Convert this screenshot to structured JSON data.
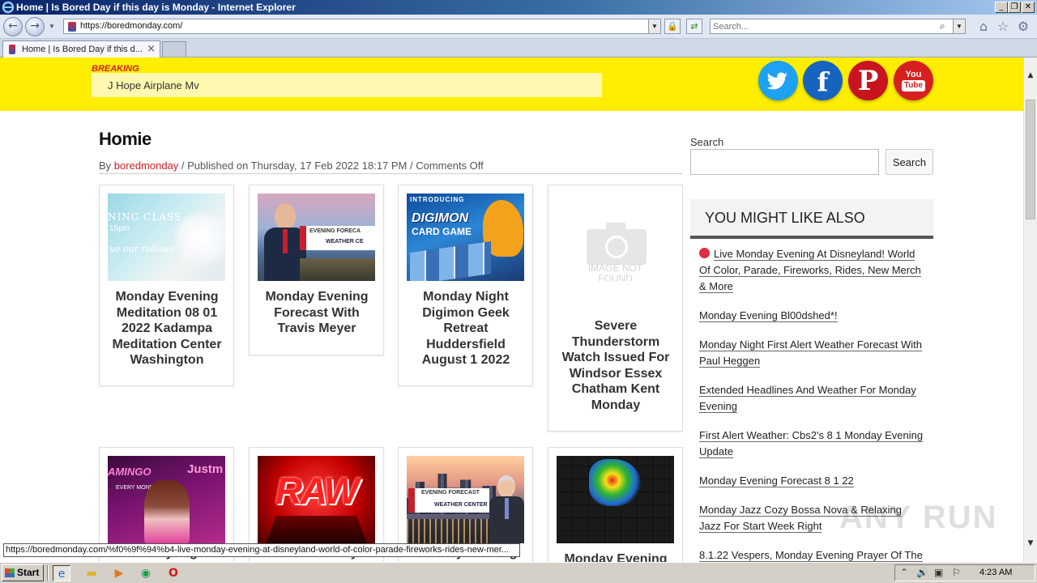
{
  "window": {
    "title": "Home | Is Bored Day if this day is Monday - Internet Explorer",
    "controls": [
      "_",
      "❐",
      "✕"
    ]
  },
  "browser": {
    "url": "https://boredmonday.com/",
    "search_placeholder": "Search...",
    "tab_title": "Home | Is Bored Day if this d...",
    "status_url": "https://boredmonday.com/%f0%9f%94%b4-live-monday-evening-at-disneyland-world-of-color-parade-fireworks-rides-new-mer..."
  },
  "header": {
    "breaking_label": "BREAKING",
    "ticker_text": "J Hope Airplane Mv",
    "social": {
      "facebook": "f",
      "pinterest": "P",
      "youtube_top": "You",
      "youtube_bottom": "Tube"
    }
  },
  "post": {
    "title": "Homie",
    "meta_by": "By ",
    "author": "boredmonday",
    "meta_rest": " / Published on Thursday, 17 Feb 2022 18:17 PM / Comments Off"
  },
  "cards": [
    {
      "title": "Monday Evening Meditation 08 01 2022 Kadampa Meditation Center Washington",
      "thumb_text": [
        "NING CLASS",
        "15pm",
        "ue our rollows"
      ]
    },
    {
      "title": "Monday Evening Forecast With Travis Meyer",
      "thumb_text": [
        "EVENING FORECA",
        "WEATHER CE"
      ]
    },
    {
      "title": "Monday Night Digimon Geek Retreat Huddersfield August 1 2022",
      "thumb_text": [
        "INTRODUCING",
        "DIGIMON",
        "CARD GAME"
      ]
    },
    {
      "title": "Severe Thunderstorm Watch Issued For Windsor Essex Chatham Kent Monday",
      "thumb_text": [
        "IMAGE NOT",
        "FOUND"
      ]
    },
    {
      "title": "Monday Night",
      "thumb_text": [
        "AMINGO",
        "Justm",
        "EVERY MONDAY"
      ]
    },
    {
      "title": "Wwe Monday",
      "thumb_text": [
        "RAW"
      ]
    },
    {
      "title": "Monday Evening",
      "thumb_text": [
        "EVENING FORECAST",
        "WEATHER CENTER"
      ]
    },
    {
      "title": "Monday Evening",
      "thumb_text": []
    }
  ],
  "sidebar": {
    "search_label": "Search",
    "search_button": "Search",
    "section_title": "YOU MIGHT LIKE ALSO",
    "links": [
      "Live Monday Evening At Disneyland! World Of Color, Parade, Fireworks, Rides, New Merch & More",
      "Monday Evening Bl00dshed*!",
      "Monday Night First Alert Weather Forecast With Paul Heggen",
      "Extended Headlines And Weather For Monday Evening",
      "First Alert Weather: Cbs2's 8 1 Monday Evening Update",
      "Monday Evening Forecast 8 1 22",
      "Monday Jazz Cozy Bossa Nova & Relaxing Jazz For Start Week Right",
      "8.1.22 Vespers, Monday Evening Prayer Of The"
    ]
  },
  "watermark": "ANY RUN",
  "taskbar": {
    "start_label": "Start",
    "clock": "4:23 AM"
  },
  "colors": {
    "header_yellow": "#ffee00",
    "accent_red": "#d0202a",
    "twitter": "#1da1f2",
    "facebook": "#1565c0",
    "pinterest": "#c8141e",
    "youtube": "#d62020"
  }
}
